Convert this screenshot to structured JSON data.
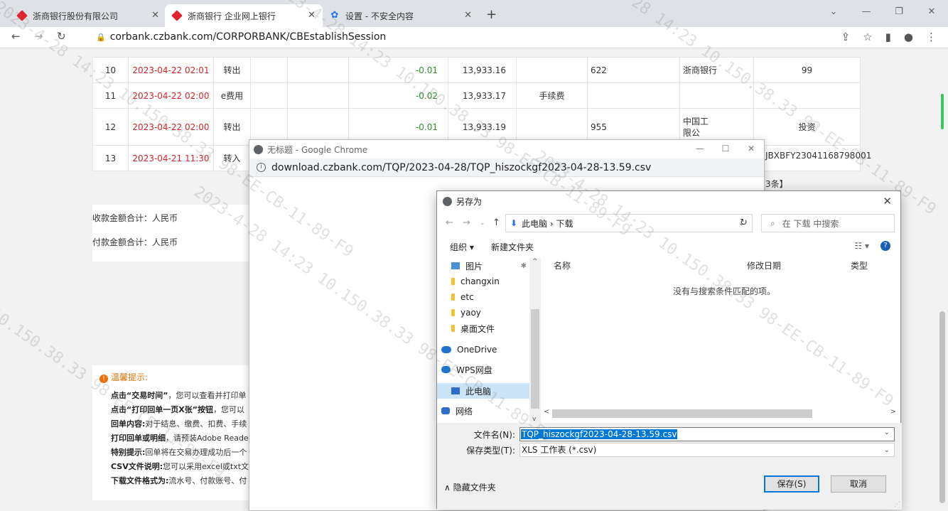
{
  "browser": {
    "tabs": [
      {
        "title": "浙商银行股份有限公司",
        "active": false
      },
      {
        "title": "浙商银行 企业网上银行",
        "active": true
      },
      {
        "title": "设置 - 不安全内容",
        "active": false
      }
    ],
    "url": "corbank.czbank.com/CORPORBANK/CBEstablishSession"
  },
  "table": {
    "rows": [
      {
        "no": "10",
        "time": "2023-04-22 02:01",
        "type": "转出",
        "amount": "-0.01",
        "balance": "13,933.16",
        "memo": "",
        "account": "622",
        "bank": "浙商银行",
        "extra": "99"
      },
      {
        "no": "11",
        "time": "2023-04-22 02:00",
        "type": "e费用",
        "amount": "-0.02",
        "balance": "13,933.17",
        "memo": "手续费",
        "account": "",
        "bank": "",
        "extra": ""
      },
      {
        "no": "12",
        "time": "2023-04-22 02:00",
        "type": "转出",
        "amount": "-0.01",
        "balance": "13,933.19",
        "memo": "",
        "account": "955",
        "bank": "中国工\n限公",
        "extra": "投资"
      },
      {
        "no": "13",
        "time": "2023-04-21 11:30",
        "type": "转入",
        "amount": "",
        "balance": "",
        "memo": "",
        "account": "",
        "bank": "",
        "extra": ""
      }
    ],
    "ref_text": "JBXBFY23041168798001",
    "count_text": "3条】"
  },
  "summary": {
    "receive_label": "收款金额合计：人民币",
    "pay_label": "付款金额合计：人民币"
  },
  "tips": {
    "title": "温馨提示:",
    "lines": [
      {
        "bold": "点击“交易时间”",
        "text": "，您可以查看并打印单"
      },
      {
        "bold": "点击“打印回单一页X张”按钮",
        "text": "，您可以"
      },
      {
        "bold": "回单内容:",
        "text": "对于结息、缴费、扣费、手续"
      },
      {
        "bold": "打印回单或明细",
        "text": "，请预装Adobe Reader"
      },
      {
        "bold": "特别提示:",
        "text": "回单将在交易办理成功后一个"
      },
      {
        "bold": "CSV文件说明:",
        "text": "您可以采用excel或txt文"
      },
      {
        "bold": "下载文件格式为:",
        "text": "流水号、付款账号、付"
      }
    ]
  },
  "popup": {
    "title": "无标题 - Google Chrome",
    "url": "download.czbank.com/TQP/2023-04-28/TQP_hiszockgf2023-04-28-13.59.csv"
  },
  "dialog": {
    "title": "另存为",
    "path": "此电脑 › 下载",
    "search_placeholder": "在 下载 中搜索",
    "organize": "组织 ▾",
    "new_folder": "新建文件夹",
    "nav_items": [
      {
        "label": "图片",
        "icon": "picture-icon"
      },
      {
        "label": "changxin",
        "icon": "folder-icon"
      },
      {
        "label": "etc",
        "icon": "folder-icon"
      },
      {
        "label": "yaoy",
        "icon": "folder-icon"
      },
      {
        "label": "桌面文件",
        "icon": "folder-icon"
      },
      {
        "label": "OneDrive",
        "icon": "cloud-icon"
      },
      {
        "label": "WPS网盘",
        "icon": "cloud-icon"
      },
      {
        "label": "此电脑",
        "icon": "computer-icon"
      },
      {
        "label": "网络",
        "icon": "network-icon"
      }
    ],
    "columns": {
      "name": "名称",
      "date": "修改日期",
      "type": "类型"
    },
    "empty_message": "没有与搜索条件匹配的项。",
    "filename_label": "文件名(N):",
    "filename_value": "TQP_hiszockgf2023-04-28-13.59.csv",
    "filetype_label": "保存类型(T):",
    "filetype_value": "XLS 工作表 (*.csv)",
    "hide_folders": "∧ 隐藏文件夹",
    "save_button": "保存(S)",
    "cancel_button": "取消"
  },
  "watermark": "2023-4-28 14:23 10.150.38.33 98-EE-CB-11-89-F9"
}
